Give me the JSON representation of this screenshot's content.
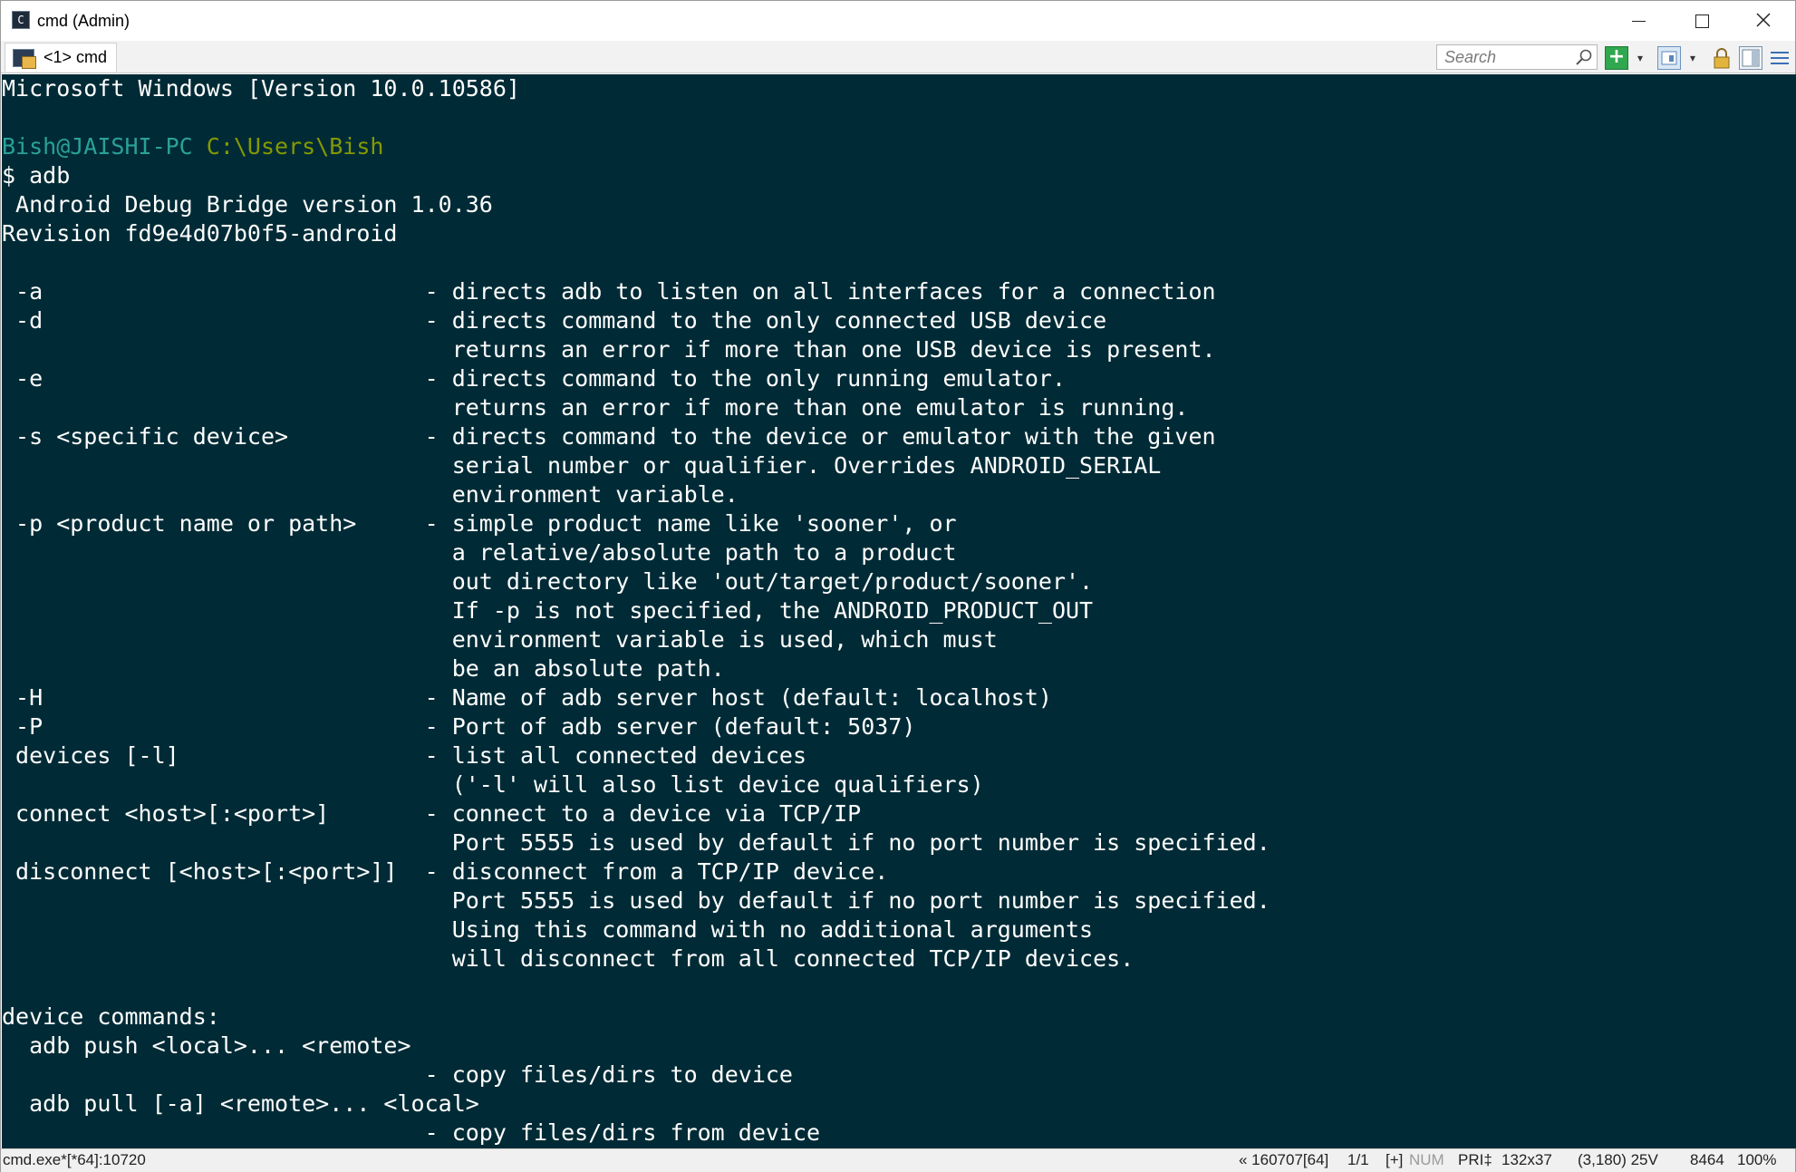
{
  "window": {
    "title": "cmd (Admin)",
    "minimize_glyph": "",
    "maximize_glyph": "",
    "close_glyph": ""
  },
  "tab": {
    "label": "<1> cmd"
  },
  "toolbar": {
    "search_placeholder": "Search",
    "add_glyph": "+",
    "dropdown_glyph": "▾"
  },
  "console": {
    "banner": "Microsoft Windows [Version 10.0.10586]",
    "prompt_user": "Bish@JAISHI-PC",
    "prompt_path": "C:\\Users\\Bish",
    "command_line": "$ adb",
    "output": " Android Debug Bridge version 1.0.36\nRevision fd9e4d07b0f5-android\n\n -a                            - directs adb to listen on all interfaces for a connection\n -d                            - directs command to the only connected USB device\n                                 returns an error if more than one USB device is present.\n -e                            - directs command to the only running emulator.\n                                 returns an error if more than one emulator is running.\n -s <specific device>          - directs command to the device or emulator with the given\n                                 serial number or qualifier. Overrides ANDROID_SERIAL\n                                 environment variable.\n -p <product name or path>     - simple product name like 'sooner', or\n                                 a relative/absolute path to a product\n                                 out directory like 'out/target/product/sooner'.\n                                 If -p is not specified, the ANDROID_PRODUCT_OUT\n                                 environment variable is used, which must\n                                 be an absolute path.\n -H                            - Name of adb server host (default: localhost)\n -P                            - Port of adb server (default: 5037)\n devices [-l]                  - list all connected devices\n                                 ('-l' will also list device qualifiers)\n connect <host>[:<port>]       - connect to a device via TCP/IP\n                                 Port 5555 is used by default if no port number is specified.\n disconnect [<host>[:<port>]]  - disconnect from a TCP/IP device.\n                                 Port 5555 is used by default if no port number is specified.\n                                 Using this command with no additional arguments\n                                 will disconnect from all connected TCP/IP devices.\n\ndevice commands:\n  adb push <local>... <remote>\n                               - copy files/dirs to device\n  adb pull [-a] <remote>... <local>\n                               - copy files/dirs from device"
  },
  "statusbar": {
    "process": "cmd.exe*[*64]:10720",
    "build": "« 160707[64]",
    "pane": "1/1",
    "plus": "[+]",
    "num": "NUM",
    "pri": "PRI‡",
    "size": "132x37",
    "cursor": "(3,180) 25V",
    "pid": "8464",
    "zoom": "100%"
  }
}
